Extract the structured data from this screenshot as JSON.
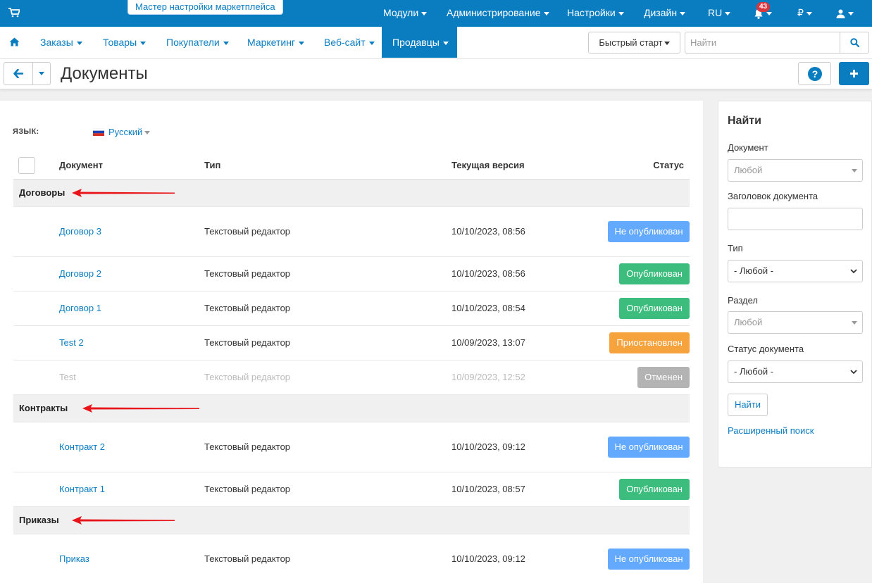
{
  "topbar": {
    "wizard": "Мастер настройки маркетплейса",
    "menu": [
      "Модули",
      "Администрирование",
      "Настройки",
      "Дизайн",
      "RU"
    ],
    "notifications": "43",
    "currency": "₽"
  },
  "nav": {
    "items": [
      "Заказы",
      "Товары",
      "Покупатели",
      "Маркетинг",
      "Веб-сайт",
      "Продавцы"
    ],
    "quickstart": "Быстрый старт",
    "search_placeholder": "Найти"
  },
  "page": {
    "title": "Документы"
  },
  "lang": {
    "label": "ЯЗЫК:",
    "value": "Русский"
  },
  "table": {
    "headers": [
      "Документ",
      "Тип",
      "Текущая версия",
      "Статус"
    ],
    "groups": [
      {
        "name": "Договоры",
        "rows": [
          {
            "doc": "Договор 3",
            "type": "Текстовый редактор",
            "version": "10/10/2023, 08:56",
            "status": "Не опубликован",
            "kind": "unpub"
          },
          {
            "doc": "Договор 2",
            "type": "Текстовый редактор",
            "version": "10/10/2023, 08:56",
            "status": "Опубликован",
            "kind": "pub"
          },
          {
            "doc": "Договор 1",
            "type": "Текстовый редактор",
            "version": "10/10/2023, 08:54",
            "status": "Опубликован",
            "kind": "pub"
          },
          {
            "doc": "Test 2",
            "type": "Текстовый редактор",
            "version": "10/09/2023, 13:07",
            "status": "Приостановлен",
            "kind": "susp"
          },
          {
            "doc": "Test",
            "type": "Текстовый редактор",
            "version": "10/09/2023, 12:52",
            "status": "Отменен",
            "kind": "cancel"
          }
        ]
      },
      {
        "name": "Контракты",
        "rows": [
          {
            "doc": "Контракт 2",
            "type": "Текстовый редактор",
            "version": "10/10/2023, 09:12",
            "status": "Не опубликован",
            "kind": "unpub"
          },
          {
            "doc": "Контракт 1",
            "type": "Текстовый редактор",
            "version": "10/10/2023, 08:57",
            "status": "Опубликован",
            "kind": "pub"
          }
        ]
      },
      {
        "name": "Приказы",
        "rows": [
          {
            "doc": "Приказ",
            "type": "Текстовый редактор",
            "version": "10/10/2023, 09:12",
            "status": "Не опубликован",
            "kind": "unpub"
          }
        ]
      }
    ]
  },
  "sidebar": {
    "title": "Найти",
    "doc_label": "Документ",
    "doc_value": "Любой",
    "heading_label": "Заголовок документа",
    "type_label": "Тип",
    "type_value": "- Любой -",
    "section_label": "Раздел",
    "section_value": "Любой",
    "status_label": "Статус документа",
    "status_value": "- Любой -",
    "find_button": "Найти",
    "advanced_link": "Расширенный поиск"
  },
  "colors": {
    "primary": "#0a7dc1",
    "published": "#3dbd7d",
    "unpublished": "#63aaff",
    "suspended": "#f6a23d",
    "cancelled": "#b3b3b3",
    "arrow": "#e8141a"
  }
}
